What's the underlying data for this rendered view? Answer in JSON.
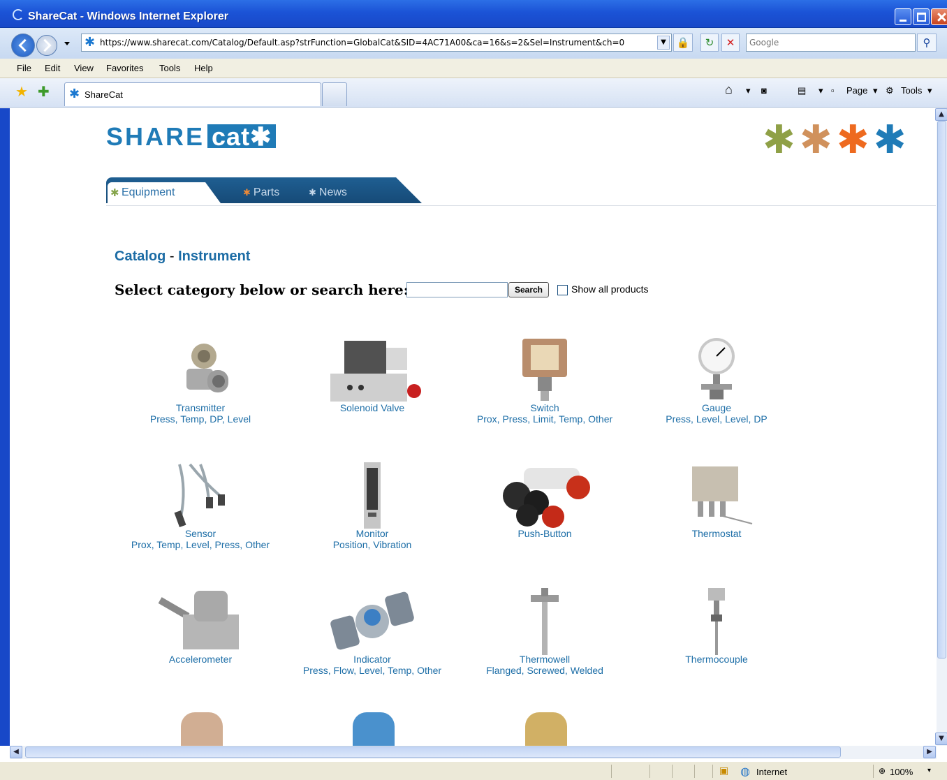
{
  "window": {
    "title": "ShareCat - Windows Internet Explorer"
  },
  "address": {
    "url": "https://www.sharecat.com/Catalog/Default.asp?strFunction=GlobalCat&SID=4AC71A00&ca=16&s=2&Sel=Instrument&ch=0"
  },
  "search_engine": {
    "placeholder": "Google"
  },
  "menu": [
    "File",
    "Edit",
    "View",
    "Favorites",
    "Tools",
    "Help"
  ],
  "tab": {
    "label": "ShareCat"
  },
  "commandbar": {
    "page": "Page",
    "tools": "Tools"
  },
  "site": {
    "logo_share": "SHARE",
    "logo_cat": "cat",
    "nav": {
      "equipment": "Equipment",
      "parts": "Parts",
      "news": "News"
    },
    "crumb": {
      "catalog": "Catalog",
      "sep": " - ",
      "section": "Instrument"
    },
    "select_label": "Select category below or search here:",
    "search_button": "Search",
    "show_all": "Show all products",
    "colors": {
      "brand": "#1f7bb7",
      "link": "#1d6ea7",
      "star1": "#8fa046",
      "star2": "#d0915c",
      "star3": "#ee6a1f",
      "star4": "#1f7bb7"
    }
  },
  "categories": [
    {
      "name": "Transmitter",
      "subs": [
        "Press",
        "Temp",
        "DP",
        "Level"
      ],
      "icon": "transmitter-icon"
    },
    {
      "name": "Solenoid Valve",
      "subs": [],
      "icon": "solenoid-valve-icon"
    },
    {
      "name": "Switch",
      "subs": [
        "Prox",
        "Press",
        "Limit",
        "Temp",
        "Other"
      ],
      "icon": "switch-icon"
    },
    {
      "name": "Gauge",
      "subs": [
        "Press",
        "Level",
        "Level",
        "DP"
      ],
      "icon": "gauge-icon"
    },
    {
      "name": "Sensor",
      "subs": [
        "Prox",
        "Temp",
        "Level",
        "Press",
        "Other"
      ],
      "icon": "sensor-icon"
    },
    {
      "name": "Monitor",
      "subs": [
        "Position",
        "Vibration"
      ],
      "icon": "monitor-icon"
    },
    {
      "name": "Push-Button",
      "subs": [],
      "icon": "push-button-icon"
    },
    {
      "name": "Thermostat",
      "subs": [],
      "icon": "thermostat-icon"
    },
    {
      "name": "Accelerometer",
      "subs": [],
      "icon": "accelerometer-icon"
    },
    {
      "name": "Indicator",
      "subs": [
        "Press",
        "Flow",
        "Level",
        "Temp",
        "Other"
      ],
      "icon": "indicator-icon"
    },
    {
      "name": "Thermowell",
      "subs": [
        "Flanged",
        "Screwed",
        "Welded"
      ],
      "icon": "thermowell-icon"
    },
    {
      "name": "Thermocouple",
      "subs": [],
      "icon": "thermocouple-icon"
    }
  ],
  "status": {
    "zone": "Internet",
    "zoom": "100%"
  }
}
